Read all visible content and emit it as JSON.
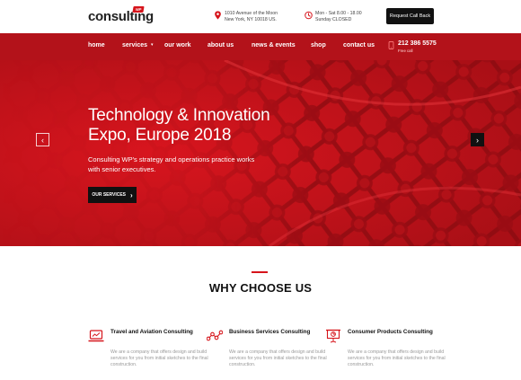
{
  "brand": {
    "name": "consulting",
    "badge": "WP"
  },
  "header": {
    "address_line1": "1010 Avenue of the Moon",
    "address_line2": "New York, NY 10018 US.",
    "hours_line1": "Mon - Sat 8.00 - 18.00",
    "hours_line2": "Sunday CLOSED",
    "callback_label": "Request Call Back"
  },
  "nav": {
    "items": [
      {
        "label": "home"
      },
      {
        "label": "services",
        "caret": "▾"
      },
      {
        "label": "our work"
      },
      {
        "label": "about us"
      },
      {
        "label": "news & events"
      },
      {
        "label": "shop"
      },
      {
        "label": "contact us"
      }
    ],
    "phone": "212 386 5575",
    "phone_sub": "Free call"
  },
  "hero": {
    "title_line1": "Technology & Innovation",
    "title_line2": "Expo, Europe 2018",
    "subtitle": "Consulting WP's strategy and operations practice works with senior executives.",
    "button_label": "OUR SERVICES",
    "button_arrow": "›",
    "prev_arrow": "‹",
    "next_arrow": "›"
  },
  "why": {
    "title": "WHY CHOOSE US",
    "features": [
      {
        "icon": "laptop-icon",
        "title": "Travel and Aviation Consulting",
        "text": "We are a company that offers design and build services for you from initial sketches to the final construction."
      },
      {
        "icon": "network-icon",
        "title": "Business Services Consulting",
        "text": "We are a company that offers design and build services for you from initial sketches to the final construction."
      },
      {
        "icon": "presentation-icon",
        "title": "Consumer Products Consulting",
        "text": "We are a company that offers design and build services for you from initial sketches to the final construction."
      }
    ]
  },
  "colors": {
    "accent": "#d6141b",
    "nav_bg": "#b3121a",
    "hero_bg": "#d3171f",
    "dark": "#111111"
  }
}
